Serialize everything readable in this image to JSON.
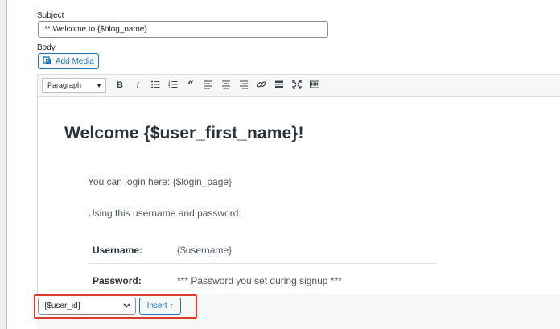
{
  "form": {
    "subject_label": "Subject",
    "subject_value": "** Welcome to {$blog_name}",
    "body_label": "Body",
    "add_media_label": "Add Media"
  },
  "toolbar": {
    "format_selected": "Paragraph",
    "buttons": [
      "bold-icon",
      "italic-icon",
      "bulleted-list-icon",
      "numbered-list-icon",
      "blockquote-icon",
      "align-left-icon",
      "align-center-icon",
      "align-right-icon",
      "link-icon",
      "read-more-icon",
      "fullscreen-icon",
      "toolbar-toggle-icon"
    ]
  },
  "content": {
    "heading": "Welcome {$user_first_name}!",
    "login_line": "You can login here: {$login_page}",
    "using_line": "Using this username and password:",
    "rows": [
      {
        "label": "Username:",
        "value": "{$username}"
      },
      {
        "label": "Password:",
        "value": "*** Password you set during signup ***"
      }
    ]
  },
  "footer": {
    "variable_selected": "{$user_id}",
    "insert_label": "Insert ↑"
  },
  "colors": {
    "accent": "#2271b1",
    "highlight": "#e03b2e"
  }
}
